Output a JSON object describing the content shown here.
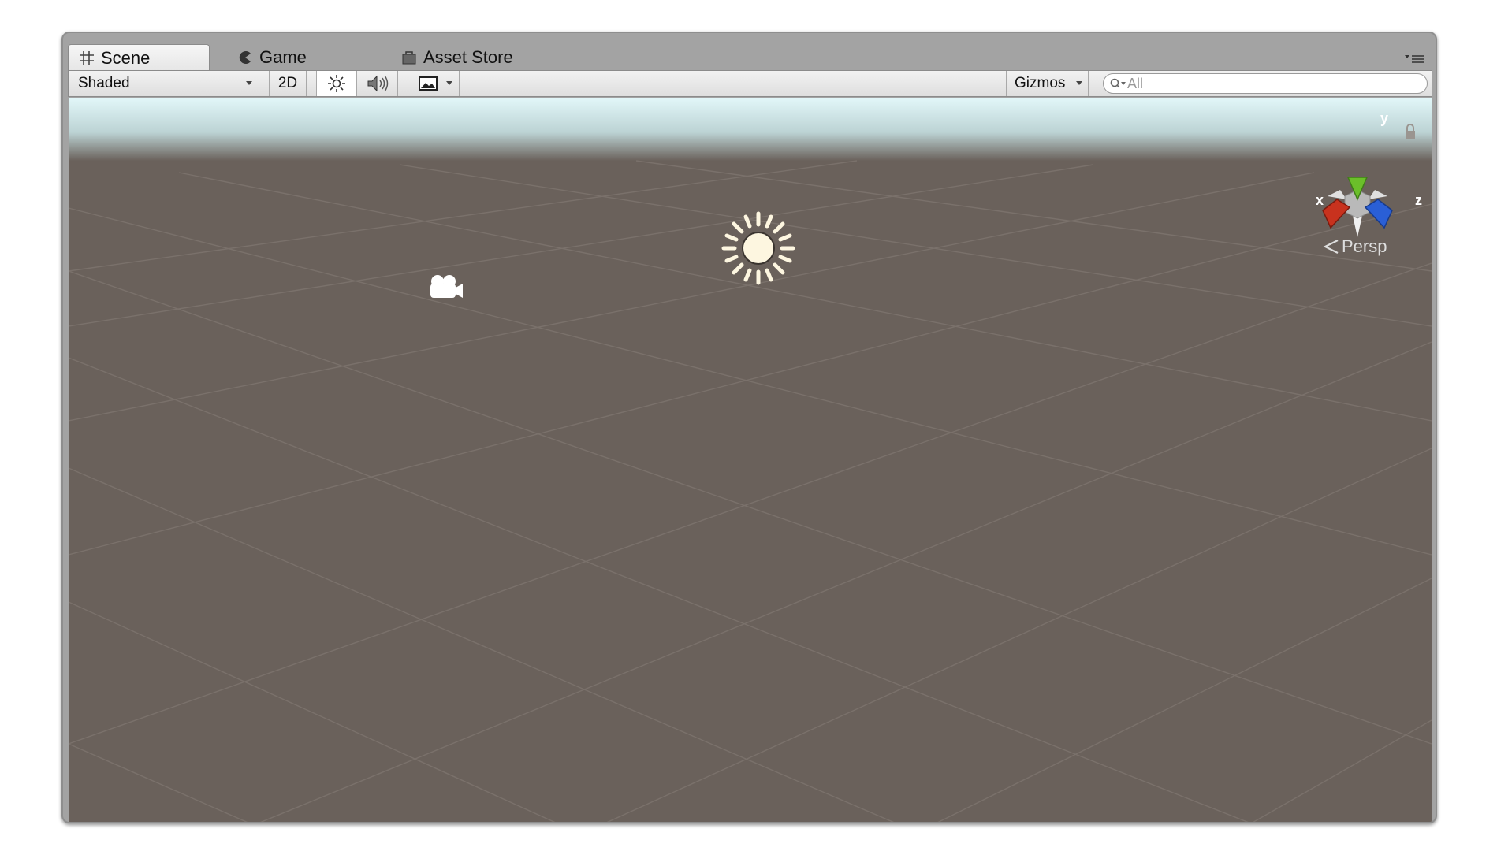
{
  "tabs": [
    {
      "label": "Scene",
      "icon": "hash-grid-icon",
      "active": true
    },
    {
      "label": "Game",
      "icon": "pacman-icon",
      "active": false
    },
    {
      "label": "Asset Store",
      "icon": "shopping-bag-icon",
      "active": false
    }
  ],
  "toolbar": {
    "draw_mode": "Shaded",
    "mode_2d": "2D",
    "lighting_icon": "sun-icon",
    "audio_icon": "speaker-icon",
    "effects_icon": "image-icon",
    "gizmos_label": "Gizmos",
    "search_placeholder": "All"
  },
  "gizmo": {
    "x_label": "x",
    "y_label": "y",
    "z_label": "z",
    "projection_label": "Persp",
    "colors": {
      "x": "#c8321e",
      "y": "#6bbf2a",
      "z": "#2a5fd6"
    }
  },
  "scene": {
    "sky_color": "#dff4f6",
    "ground_color": "#6a615b",
    "objects": [
      {
        "name": "directional-light",
        "icon": "sun-icon"
      },
      {
        "name": "main-camera",
        "icon": "camera-icon"
      }
    ]
  }
}
